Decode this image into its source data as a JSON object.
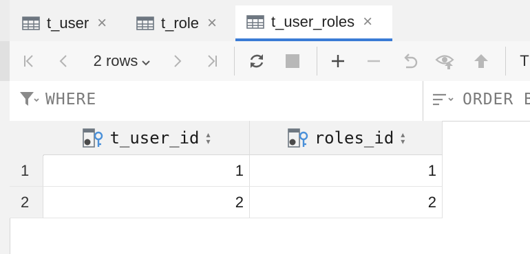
{
  "tabs": [
    {
      "label": "t_user",
      "active": false
    },
    {
      "label": "t_role",
      "active": false
    },
    {
      "label": "t_user_roles",
      "active": true
    }
  ],
  "toolbar": {
    "rows_label": "2 rows",
    "overflow_label": "T"
  },
  "filter": {
    "where_placeholder": "WHERE",
    "order_placeholder": "ORDER B"
  },
  "table": {
    "columns": [
      "t_user_id",
      "roles_id"
    ],
    "rows": [
      {
        "num": "1",
        "cells": [
          "1",
          "1"
        ]
      },
      {
        "num": "2",
        "cells": [
          "2",
          "2"
        ]
      }
    ]
  },
  "colors": {
    "accent": "#3a7bd5",
    "key_icon": "#4a90d9"
  }
}
